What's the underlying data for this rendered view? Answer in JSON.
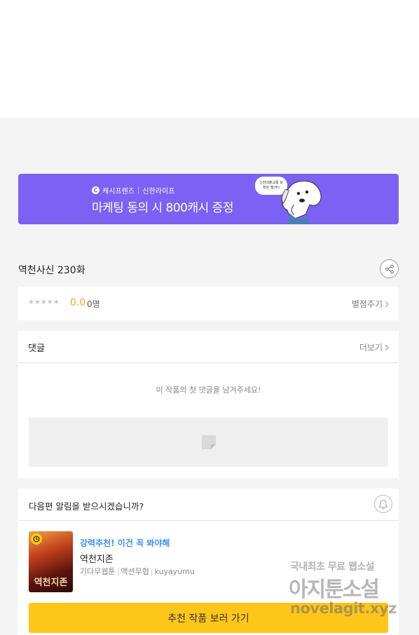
{
  "banner": {
    "brand_left": "캐시프렌즈",
    "brand_sep": "|",
    "brand_right": "신한라이프",
    "headline": "마케팅 동의 시 800캐시 증정",
    "bubble_text": "신한대출교통 보장된 펄(무)",
    "bg_color": "#7b61f4"
  },
  "episode": {
    "title": "역천사신 230화"
  },
  "rating": {
    "stars": "★★★★★",
    "score": "0.0",
    "count": "0명",
    "rate_link": "별점주기"
  },
  "comments": {
    "title": "댓글",
    "more": "더보기",
    "empty_message": "이 작품의 첫 댓글을 남겨주세요!"
  },
  "notify": {
    "question": "다음편 알림을 받으시겠습니까?"
  },
  "recommendation": {
    "tag": "강력추천! 이건 꼭 봐야해",
    "title": "역천지존",
    "genre": "기다무웹툰",
    "category": "액션무협",
    "author": "kuyayumu",
    "meta_sep": "|",
    "thumb_text": "역천지존",
    "tag_color": "#3f8ef5"
  },
  "cta": {
    "label": "추천 작품 보러 가기",
    "color": "#ffc61a"
  },
  "watermark": {
    "line1": "국내최초 무료 웹소설",
    "line2": "아지툰소설",
    "line3": "novelagit.xyz"
  }
}
